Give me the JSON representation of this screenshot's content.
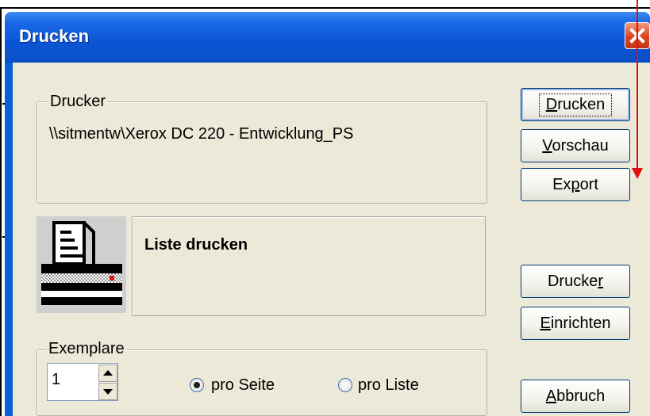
{
  "window": {
    "title": "Drucken"
  },
  "printer_group": {
    "legend": "Drucker",
    "name": "\\\\sitmentw\\Xerox DC 220 - Entwicklung_PS"
  },
  "panel": {
    "text": "Liste drucken"
  },
  "copies_group": {
    "legend": "Exemplare",
    "value": "1",
    "options": [
      {
        "label": "pro Seite",
        "selected": true
      },
      {
        "label": "pro Liste",
        "selected": false
      }
    ]
  },
  "buttons": {
    "print": {
      "pre": "",
      "mn": "D",
      "post": "rucken"
    },
    "preview": {
      "pre": "",
      "mn": "V",
      "post": "orschau"
    },
    "export": {
      "pre": "Ex",
      "mn": "p",
      "post": "ort"
    },
    "printer": {
      "pre": "Drucke",
      "mn": "r",
      "post": ""
    },
    "setup": {
      "pre": "",
      "mn": "E",
      "post": "inrichten"
    },
    "cancel": {
      "pre": "",
      "mn": "A",
      "post": "bbruch"
    }
  },
  "colors": {
    "titlebar": "#0a55d5",
    "client": "#ece9d8",
    "close": "#d9431e",
    "annotation_arrow": "#e01010"
  },
  "icons": {
    "close": "close-x-icon",
    "printer": "printer-icon",
    "spin": "spin-arrow-icons"
  }
}
